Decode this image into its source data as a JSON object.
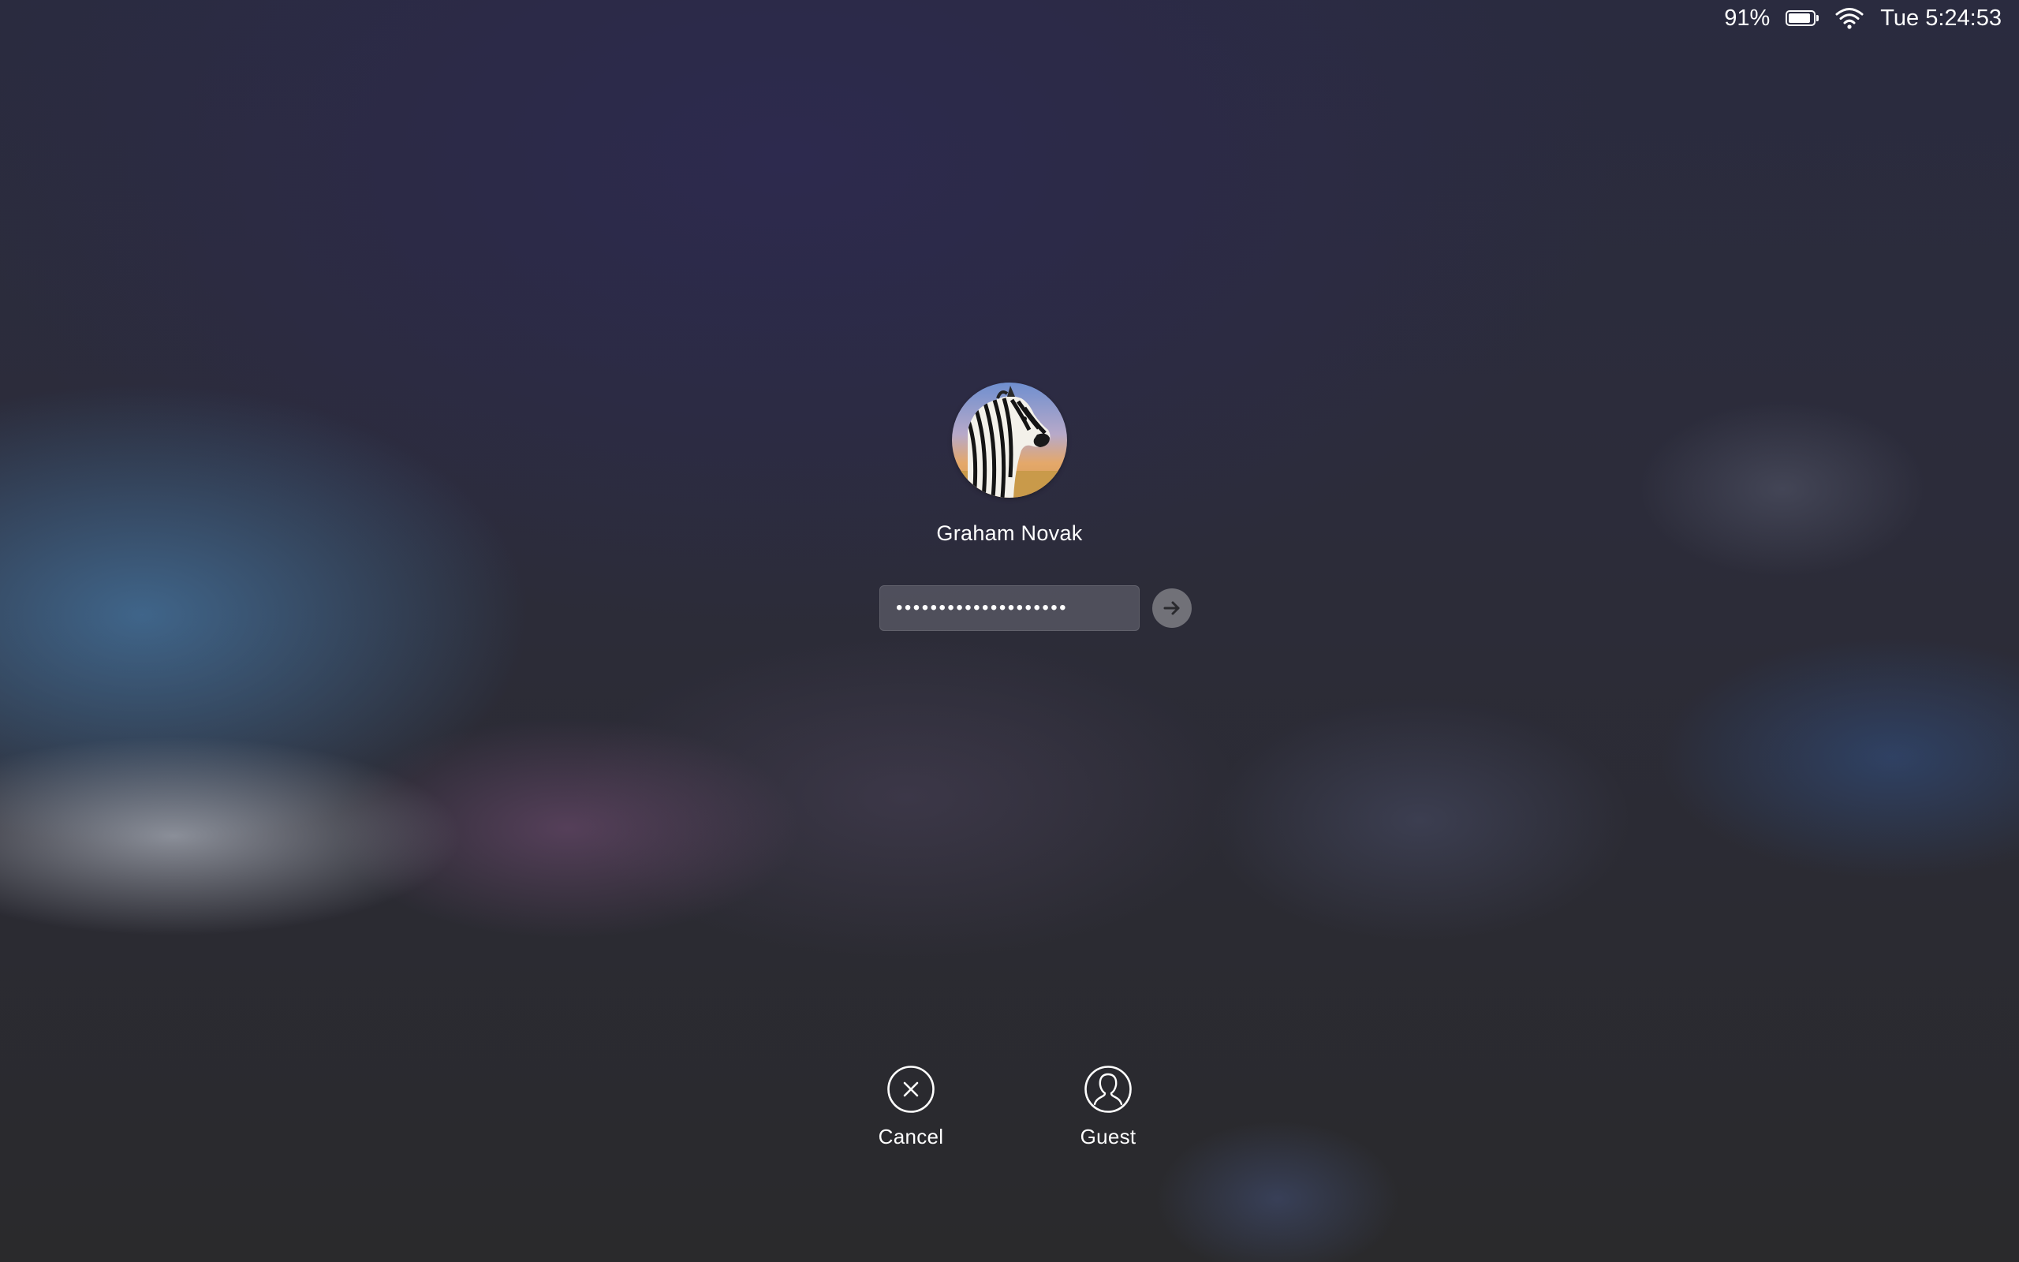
{
  "status_bar": {
    "battery_percent": "91%",
    "battery_level": 0.91,
    "wifi_icon": "wifi-icon",
    "clock": "Tue 5:24:53"
  },
  "login": {
    "avatar_icon": "zebra-avatar",
    "user_name": "Graham Novak",
    "password_masked": "••••••••••••••••••••",
    "submit_icon": "arrow-right-icon"
  },
  "actions": {
    "cancel_label": "Cancel",
    "cancel_icon": "close-circle-icon",
    "guest_label": "Guest",
    "guest_icon": "user-outline-icon"
  }
}
